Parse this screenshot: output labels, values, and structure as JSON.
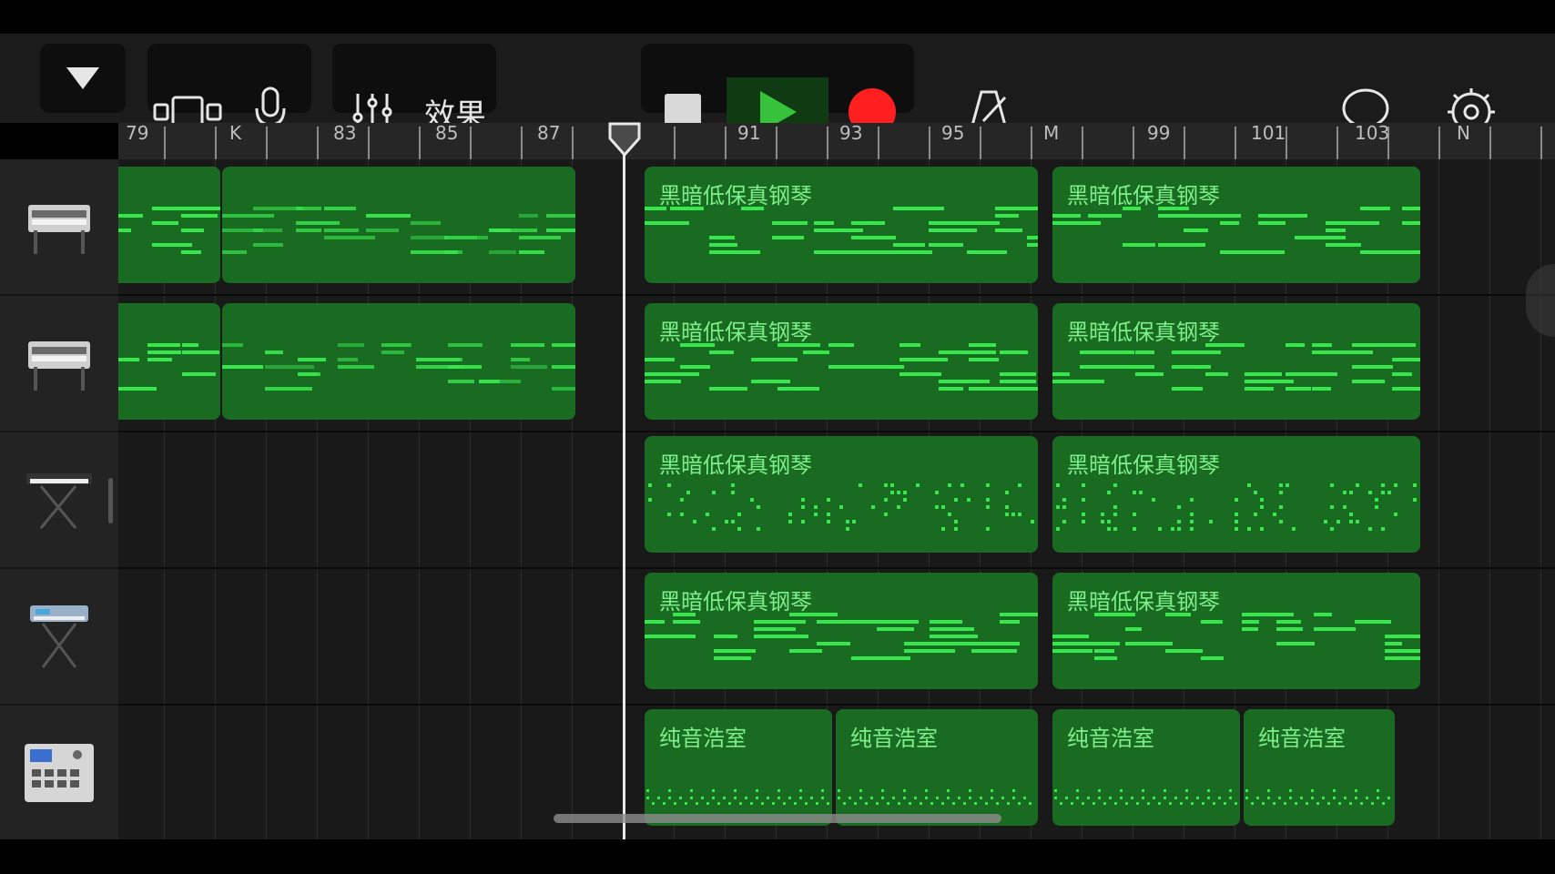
{
  "toolbar": {
    "effects_label": "效果",
    "icons": [
      "triangle-down-icon",
      "tracks-view-icon",
      "microphone-icon",
      "mixer-icon",
      "stop-icon",
      "play-icon",
      "record-icon",
      "metronome-icon",
      "loop-icon",
      "settings-icon"
    ],
    "accent_play": "#36c23a",
    "accent_record": "#ff1f1f"
  },
  "ruler": {
    "labels": [
      "79",
      "K",
      "83",
      "85",
      "87",
      "91",
      "93",
      "95",
      "M",
      "99",
      "101",
      "103",
      "N"
    ]
  },
  "tracks": [
    {
      "instrument": "electric-piano-icon"
    },
    {
      "instrument": "electric-piano-icon"
    },
    {
      "instrument": "keyboard-stand-icon"
    },
    {
      "instrument": "synth-stand-icon"
    },
    {
      "instrument": "drum-machine-icon"
    }
  ],
  "regions": {
    "piano_name": "黑暗低保真钢琴",
    "drum_name": "纯音浩室"
  },
  "colors": {
    "region_fill": "#1a6b22",
    "note": "#36e84c",
    "region_label": "#7ef08a"
  }
}
